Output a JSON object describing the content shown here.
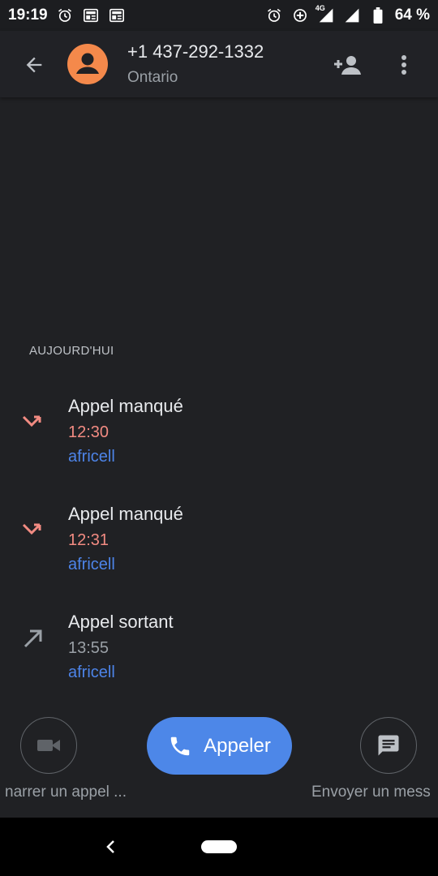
{
  "status_bar": {
    "time": "19:19",
    "battery": "64 %",
    "network": "4G",
    "icons_left": [
      "alarm-icon",
      "newspaper-icon",
      "newspaper-icon"
    ],
    "icons_right": [
      "alarm-icon",
      "data-saver-icon",
      "signal-icon",
      "signal-icon",
      "battery-icon"
    ]
  },
  "header": {
    "number": "+1 437-292-1332",
    "region": "Ontario",
    "avatar_color": "#f4894b"
  },
  "history": {
    "section_title": "AUJOURD'HUI",
    "items": [
      {
        "type": "Appel manqué",
        "time": "12:30",
        "carrier": "africell",
        "icon": "missed-call-icon"
      },
      {
        "type": "Appel manqué",
        "time": "12:31",
        "carrier": "africell",
        "icon": "missed-call-icon"
      },
      {
        "type": "Appel sortant",
        "time": "13:55",
        "carrier": "africell",
        "icon": "outgoing-call-icon"
      }
    ]
  },
  "actions": {
    "video_label": "narrer un appel ...",
    "call_label": "Appeler",
    "message_label": "Envoyer un mess"
  },
  "colors": {
    "background": "#202124",
    "missed": "#f28b82",
    "accent": "#4d87e8"
  }
}
